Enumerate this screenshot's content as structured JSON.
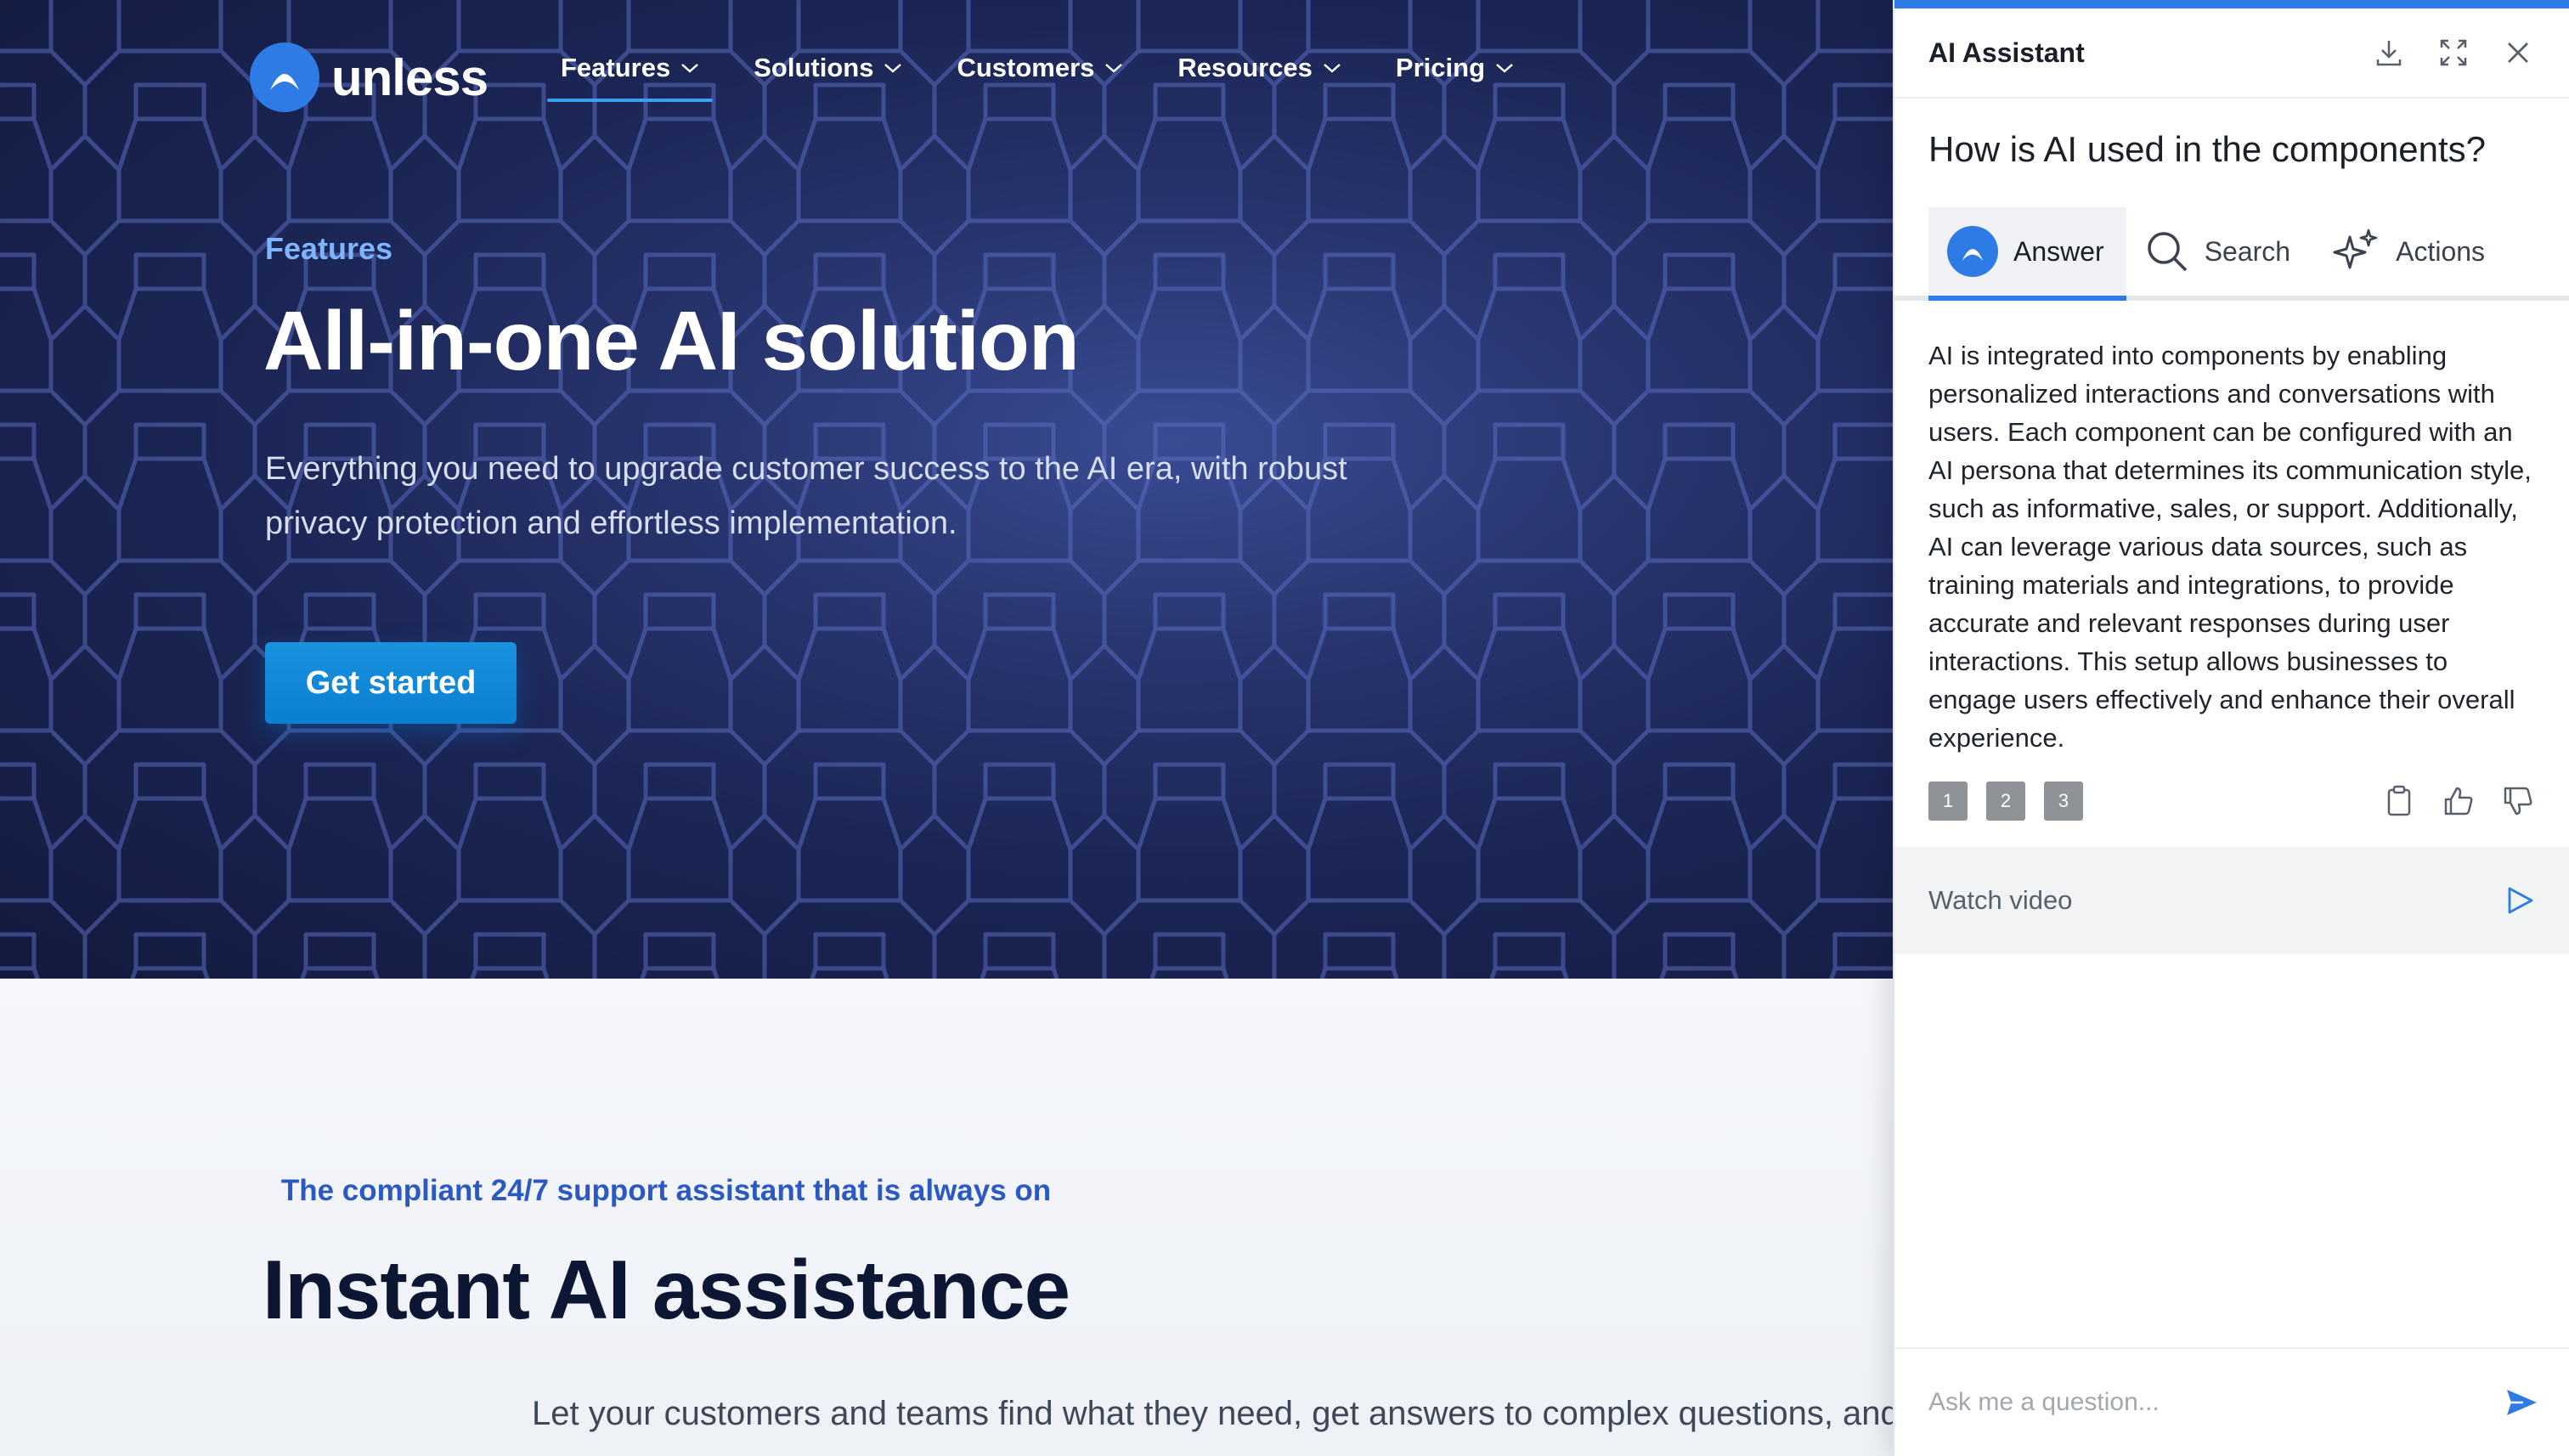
{
  "brand": {
    "name": "unless",
    "accent": "#2f7be6"
  },
  "nav": {
    "items": [
      {
        "label": "Features",
        "active": true
      },
      {
        "label": "Solutions"
      },
      {
        "label": "Customers"
      },
      {
        "label": "Resources"
      },
      {
        "label": "Pricing"
      }
    ]
  },
  "hero": {
    "eyebrow": "Features",
    "title": "All-in-one AI solution",
    "subtitle_line1": "Everything you need to upgrade customer success to the AI era, with robust",
    "subtitle_line2": "privacy protection and effortless implementation.",
    "cta": "Get started"
  },
  "section": {
    "eyebrow": "The compliant 24/7 support assistant that is always on",
    "title": "Instant AI assistance",
    "subtitle": "Let your customers and teams find what they need, get answers to complex questions, and"
  },
  "assistant": {
    "title": "AI Assistant",
    "header_icons": [
      "download-icon",
      "expand-icon",
      "close-icon"
    ],
    "question": "How is AI used in the components?",
    "tabs": [
      {
        "label": "Answer",
        "icon": "avatar-icon",
        "active": true
      },
      {
        "label": "Search",
        "icon": "search-icon"
      },
      {
        "label": "Actions",
        "icon": "sparkles-icon"
      }
    ],
    "answer": "AI is integrated into components by enabling personalized interactions and conversations with users. Each component can be configured with an AI persona that determines its communication style, such as informative, sales, or support. Additionally, AI can leverage various data sources, such as training materials and integrations, to provide accurate and relevant responses during user interactions. This setup allows businesses to engage users effectively and enhance their overall experience.",
    "citations": [
      "1",
      "2",
      "3"
    ],
    "feedback_icons": [
      "clipboard-icon",
      "thumbs-up-icon",
      "thumbs-down-icon"
    ],
    "video_label": "Watch video",
    "input_placeholder": "Ask me a question..."
  }
}
